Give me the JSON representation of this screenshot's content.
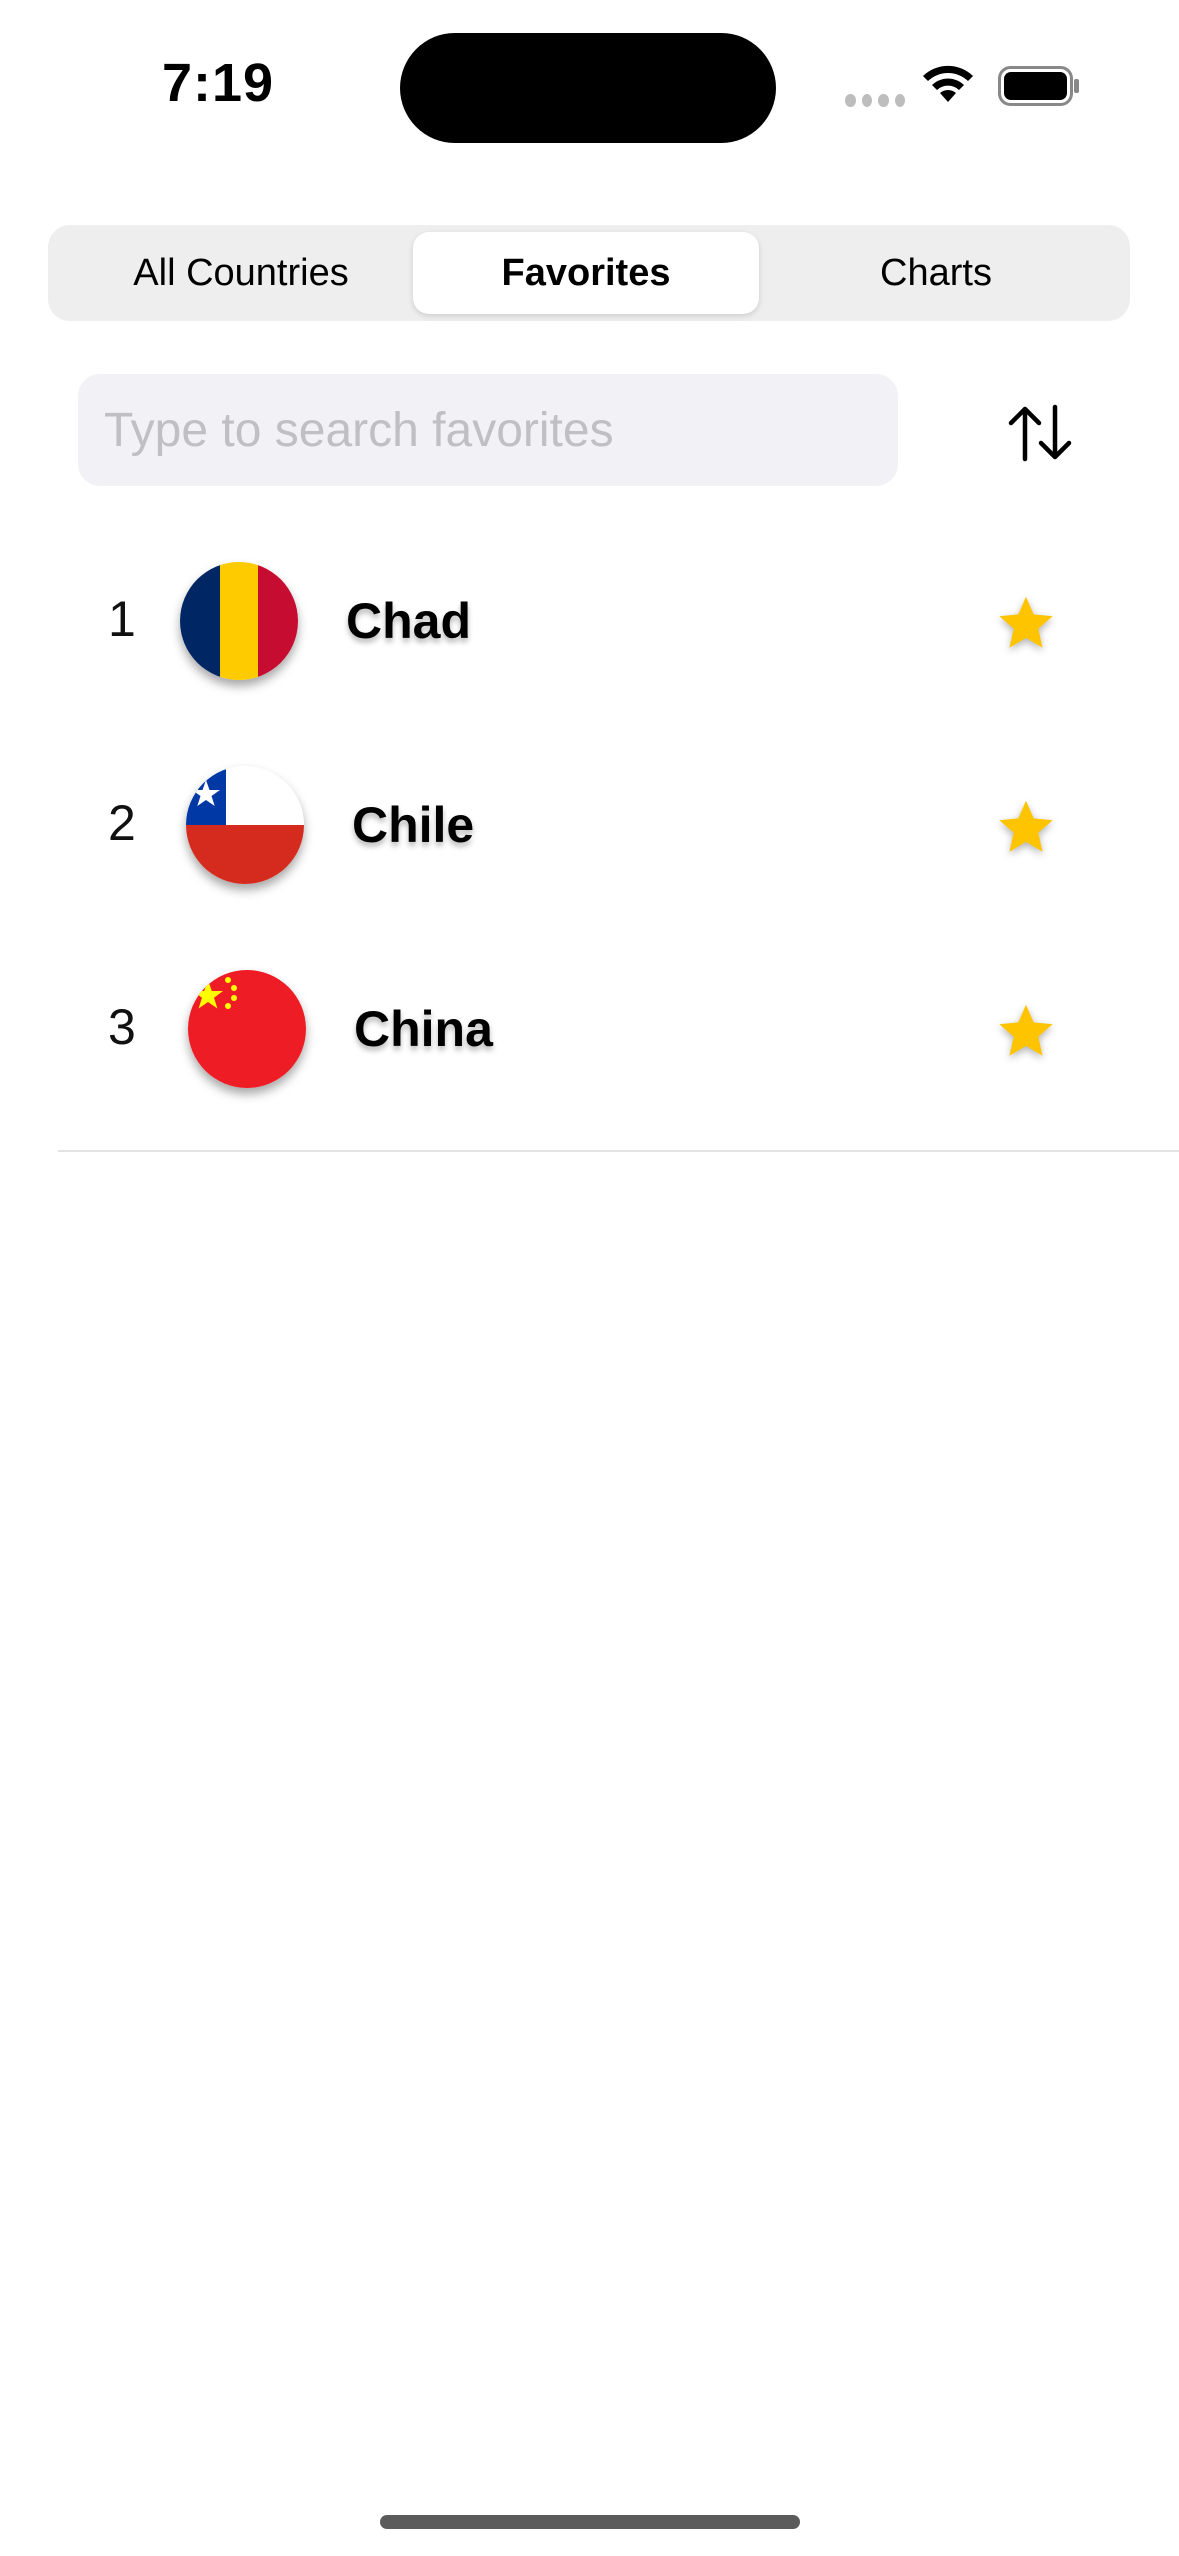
{
  "status_bar": {
    "time": "7:19"
  },
  "tabs": [
    {
      "label": "All Countries",
      "active": false
    },
    {
      "label": "Favorites",
      "active": true
    },
    {
      "label": "Charts",
      "active": false
    }
  ],
  "search": {
    "placeholder": "Type to search favorites",
    "value": ""
  },
  "sort_icon": "arrow-up-down-icon",
  "favorites": [
    {
      "rank": "1",
      "name": "Chad",
      "flag": "flag-chad-icon",
      "favorited": true
    },
    {
      "rank": "2",
      "name": "Chile",
      "flag": "flag-chile-icon",
      "favorited": true
    },
    {
      "rank": "3",
      "name": "China",
      "flag": "flag-china-icon",
      "favorited": true
    }
  ],
  "colors": {
    "star": "#FFC400",
    "active_segment_bg": "#FFFFFF",
    "segmented_bg": "#EEEEEF",
    "search_bg": "#F1F1F6"
  }
}
